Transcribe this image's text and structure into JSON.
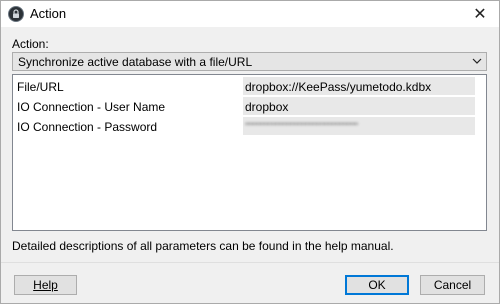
{
  "window": {
    "title": "Action",
    "close_glyph": "✕"
  },
  "action": {
    "label": "Action:",
    "selected": "Synchronize active database with a file/URL"
  },
  "parameters": [
    {
      "name": "File/URL",
      "value": "dropbox://KeePass/yumetodo.kdbx"
    },
    {
      "name": "IO Connection - User Name",
      "value": "dropbox"
    },
    {
      "name": "IO Connection - Password",
      "value": "\"\"\"\"\"\"\"\"\"\"\"\"\"\"\"\"\"\"\"\"\"\"\"\"\"\"\"\"\"\""
    }
  ],
  "hint": "Detailed descriptions of all parameters can be found in the help manual.",
  "buttons": {
    "help": "Help",
    "ok": "OK",
    "cancel": "Cancel"
  },
  "icons": {
    "app": "keepass-lock-icon",
    "close": "close-icon",
    "dropdown": "chevron-down-icon"
  },
  "colors": {
    "default_button_border": "#0078d7",
    "value_field_bg": "#e8e8e8"
  }
}
